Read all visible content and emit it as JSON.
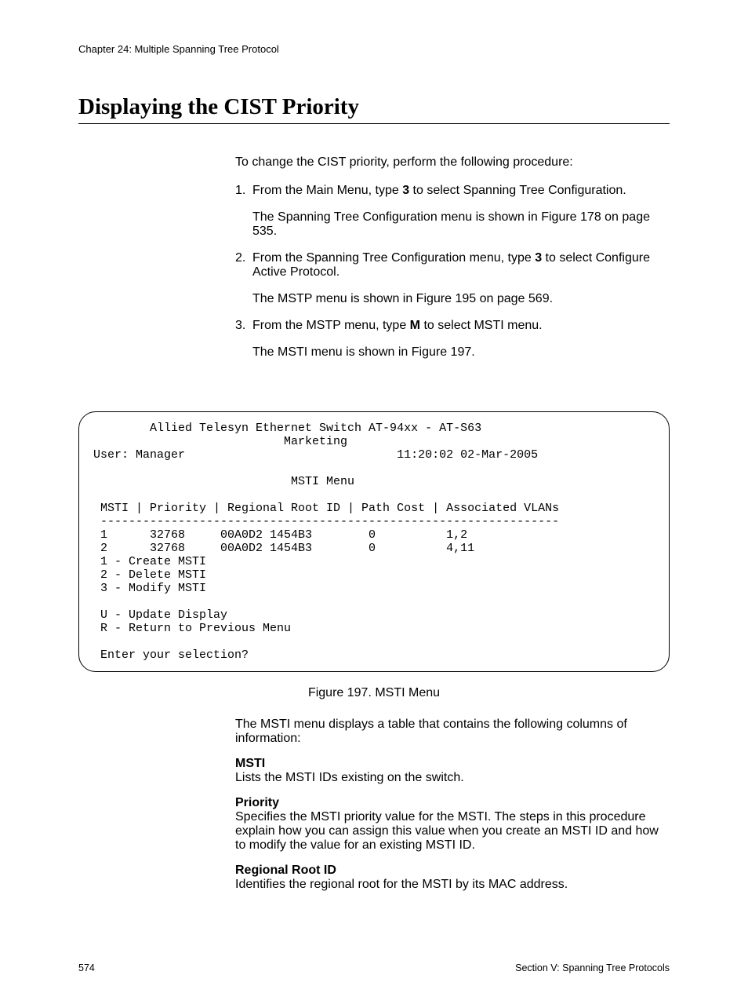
{
  "header": {
    "chapter": "Chapter 24: Multiple Spanning Tree Protocol"
  },
  "title": "Displaying the CIST Priority",
  "intro": "To change the CIST priority, perform the following procedure:",
  "steps": [
    {
      "num": "1.",
      "pre": "From the Main Menu, type ",
      "bold": "3",
      "post": " to select Spanning Tree Configuration.",
      "sub": "The Spanning Tree Configuration menu is shown in Figure 178 on page 535."
    },
    {
      "num": "2.",
      "pre": "From the Spanning Tree Configuration menu, type ",
      "bold": "3",
      "post": " to select Configure Active Protocol.",
      "sub": "The MSTP menu is shown in Figure 195 on page 569."
    },
    {
      "num": "3.",
      "pre": "From the MSTP menu, type ",
      "bold": "M",
      "post": " to select MSTI menu.",
      "sub": "The MSTI menu is shown in Figure 197."
    }
  ],
  "terminal": {
    "title_line": "        Allied Telesyn Ethernet Switch AT-94xx - AT-S63",
    "subtitle": "                           Marketing",
    "user_line": "User: Manager                              11:20:02 02-Mar-2005",
    "menu_line": "                            MSTI Menu",
    "table_hdr": " MSTI | Priority | Regional Root ID | Path Cost | Associated VLANs",
    "table_sep": " -----------------------------------------------------------------",
    "row1": " 1      32768     00A0D2 1454B3        0          1,2",
    "row2": " 2      32768     00A0D2 1454B3        0          4,11",
    "opt1": " 1 - Create MSTI",
    "opt2": " 2 - Delete MSTI",
    "opt3": " 3 - Modify MSTI",
    "optU": " U - Update Display",
    "optR": " R - Return to Previous Menu",
    "prompt": " Enter your selection?"
  },
  "figure_caption": "Figure 197. MSTI Menu",
  "post_figure": "The MSTI menu displays a table that contains the following columns of information:",
  "definitions": [
    {
      "title": "MSTI",
      "body": "Lists the MSTI IDs existing on the switch."
    },
    {
      "title": "Priority",
      "body": "Specifies the MSTI priority value for the MSTI. The steps in this procedure explain how you can assign this value when you create an MSTI ID and how to modify the value for an existing MSTI ID."
    },
    {
      "title": "Regional Root ID",
      "body": "Identifies the regional root for the MSTI by its MAC address."
    }
  ],
  "footer": {
    "page": "574",
    "section": "Section V: Spanning Tree Protocols"
  }
}
